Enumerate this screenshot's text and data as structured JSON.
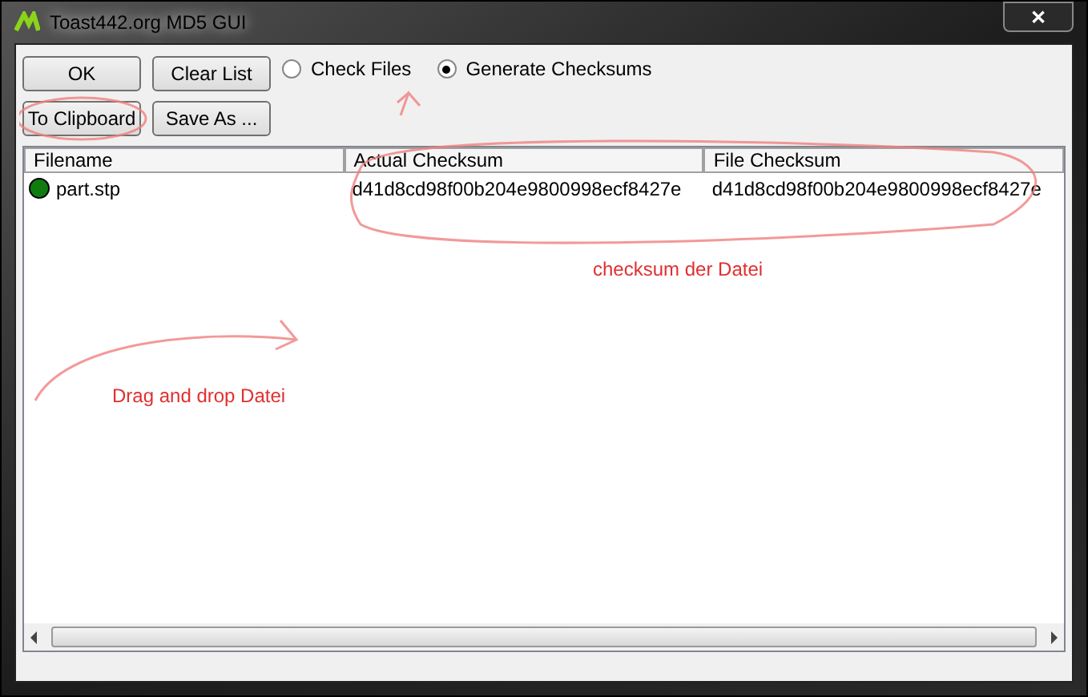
{
  "window": {
    "title": "Toast442.org MD5 GUI",
    "close": "✕"
  },
  "buttons": [
    {
      "label": "OK"
    },
    {
      "label": "Clear List"
    },
    {
      "label": "To Clipboard"
    },
    {
      "label": "Save As ..."
    }
  ],
  "modes": [
    {
      "label": "Check Files",
      "selected": false
    },
    {
      "label": "Generate Checksums",
      "selected": true
    }
  ],
  "table": {
    "columns": [
      "Filename",
      "Actual Checksum",
      "File Checksum"
    ],
    "rows": [
      {
        "filename": "part.stp",
        "actual": "d41d8cd98f00b204e9800998ecf8427e",
        "file": "d41d8cd98f00b204e9800998ecf8427e",
        "color": "#107c10"
      }
    ]
  },
  "annotations": [
    {
      "text": "checksum der Datei"
    },
    {
      "text": "Drag and drop Datei"
    }
  ]
}
